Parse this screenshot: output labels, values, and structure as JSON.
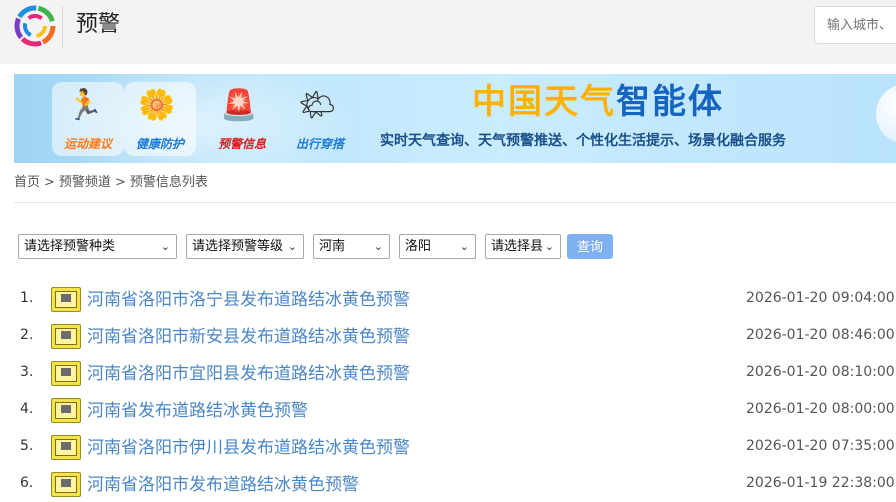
{
  "header": {
    "logo_icon": "weather-logo-icon",
    "title": "预警",
    "search_placeholder": "输入城市、"
  },
  "banner": {
    "tiles": [
      {
        "label": "运动建议",
        "icon": "runner-icon"
      },
      {
        "label": "健康防护",
        "icon": "flower-icon"
      },
      {
        "label": "预警信息",
        "icon": "siren-icon"
      },
      {
        "label": "出行穿搭",
        "icon": "sun-icon"
      }
    ],
    "brand_part1": "中国天气",
    "brand_part2": "智能体",
    "slogan": "实时天气查询、天气预警推送、个性化生活提示、场景化融合服务"
  },
  "breadcrumb": {
    "home": "首页",
    "sep1": ">",
    "channel": "预警频道",
    "sep2": ">",
    "current": "预警信息列表"
  },
  "filters": {
    "type": "请选择预警种类",
    "level": "请选择预警等级",
    "province": "河南",
    "city": "洛阳",
    "county": "请选择县",
    "query_label": "查询"
  },
  "alerts": [
    {
      "num": "1.",
      "title": "河南省洛阳市洛宁县发布道路结冰黄色预警",
      "time": "2026-01-20 09:04:00",
      "level_color": "#f3e24a"
    },
    {
      "num": "2.",
      "title": "河南省洛阳市新安县发布道路结冰黄色预警",
      "time": "2026-01-20 08:46:00",
      "level_color": "#f3e24a"
    },
    {
      "num": "3.",
      "title": "河南省洛阳市宜阳县发布道路结冰黄色预警",
      "time": "2026-01-20 08:10:00",
      "level_color": "#f3e24a"
    },
    {
      "num": "4.",
      "title": "河南省发布道路结冰黄色预警",
      "time": "2026-01-20 08:00:00",
      "level_color": "#f3e24a"
    },
    {
      "num": "5.",
      "title": "河南省洛阳市伊川县发布道路结冰黄色预警",
      "time": "2026-01-20 07:35:00",
      "level_color": "#f3e24a"
    },
    {
      "num": "6.",
      "title": "河南省洛阳市发布道路结冰黄色预警",
      "time": "2026-01-19 22:38:00",
      "level_color": "#f3e24a"
    }
  ]
}
